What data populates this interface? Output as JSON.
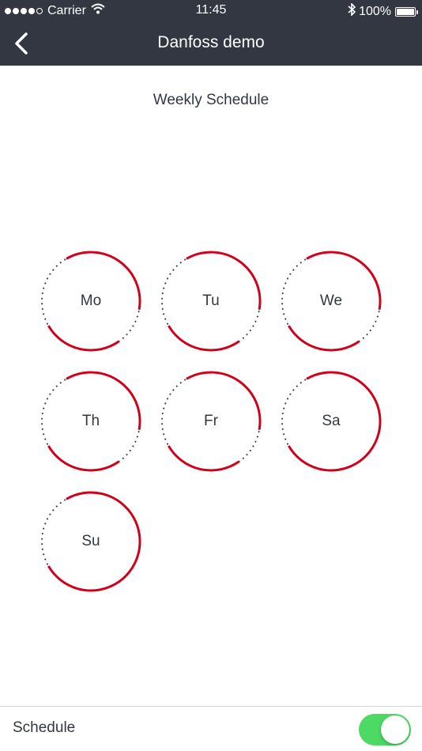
{
  "status_bar": {
    "carrier": "Carrier",
    "time": "11:45",
    "battery_percent": "100%",
    "battery_level": 1.0,
    "signal_bars_filled": 4,
    "signal_bars_total": 5
  },
  "nav": {
    "title": "Danfoss demo",
    "back_icon": "chevron-left-icon"
  },
  "schedule": {
    "title": "Weekly Schedule",
    "days": [
      {
        "label": "Mo",
        "active_arcs": [
          [
            -30,
            100
          ],
          [
            145,
            240
          ]
        ]
      },
      {
        "label": "Tu",
        "active_arcs": [
          [
            -30,
            100
          ],
          [
            145,
            240
          ]
        ]
      },
      {
        "label": "We",
        "active_arcs": [
          [
            -30,
            100
          ],
          [
            145,
            240
          ]
        ]
      },
      {
        "label": "Th",
        "active_arcs": [
          [
            -30,
            100
          ],
          [
            145,
            240
          ]
        ]
      },
      {
        "label": "Fr",
        "active_arcs": [
          [
            -30,
            100
          ],
          [
            145,
            240
          ]
        ]
      },
      {
        "label": "Sa",
        "active_arcs": [
          [
            -30,
            240
          ]
        ]
      },
      {
        "label": "Su",
        "active_arcs": [
          [
            -30,
            240
          ]
        ]
      }
    ]
  },
  "bottom": {
    "label": "Schedule",
    "toggle_on": true
  },
  "colors": {
    "bar_bg": "#323741",
    "accent_red": "#d0021b",
    "text": "#323741",
    "toggle_on": "#4cd964"
  }
}
